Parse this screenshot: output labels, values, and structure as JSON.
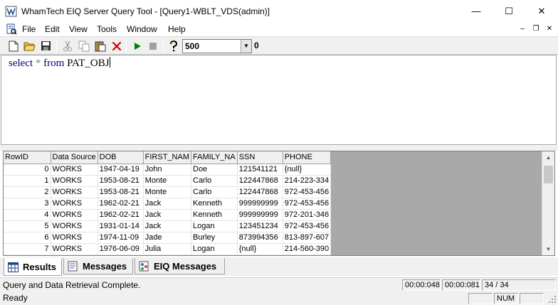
{
  "window": {
    "title": "WhamTech EIQ Server Query Tool - [Query1-WBLT_VDS(admin)]",
    "controls": {
      "minimize": "—",
      "maximize": "☐",
      "close": "✕"
    }
  },
  "menu": {
    "items": [
      "File",
      "Edit",
      "View",
      "Tools",
      "Window",
      "Help"
    ],
    "mdi_controls": {
      "minimize": "–",
      "restore": "❐",
      "close": "✕"
    }
  },
  "toolbar": {
    "row_limit_value": "500",
    "result_count": "0",
    "icons": [
      "new-document-icon",
      "open-folder-icon",
      "save-icon",
      "cut-icon",
      "copy-icon",
      "paste-icon",
      "delete-icon",
      "run-icon",
      "stop-icon",
      "help-icon"
    ]
  },
  "editor": {
    "kw_select": "select",
    "op_star": "*",
    "kw_from": "from",
    "table_name": "PAT_OBJ"
  },
  "grid": {
    "columns": [
      "RowID",
      "Data Source",
      "DOB",
      "FIRST_NAM",
      "FAMILY_NA",
      "SSN",
      "PHONE"
    ],
    "rows": [
      [
        "0",
        "WORKS",
        "1947-04-19",
        "John",
        "Doe",
        "121541121",
        "{null}"
      ],
      [
        "1",
        "WORKS",
        "1953-08-21",
        "Monte",
        "Carlo",
        "122447868",
        "214-223-334"
      ],
      [
        "2",
        "WORKS",
        "1953-08-21",
        "Monte",
        "Carlo",
        "122447868",
        "972-453-456"
      ],
      [
        "3",
        "WORKS",
        "1962-02-21",
        "Jack",
        "Kenneth",
        "999999999",
        "972-453-456"
      ],
      [
        "4",
        "WORKS",
        "1962-02-21",
        "Jack",
        "Kenneth",
        "999999999",
        "972-201-346"
      ],
      [
        "5",
        "WORKS",
        "1931-01-14",
        "Jack",
        "Logan",
        "123451234",
        "972-453-456"
      ],
      [
        "6",
        "WORKS",
        "1974-11-09",
        "Jade",
        "Burley",
        "873994356",
        "813-897-607"
      ],
      [
        "7",
        "WORKS",
        "1976-06-09",
        "Julia",
        "Logan",
        "{null}",
        "214-560-390"
      ]
    ]
  },
  "tabs": [
    {
      "label": "Results",
      "icon": "results-grid-icon",
      "active": true
    },
    {
      "label": "Messages",
      "icon": "messages-icon",
      "active": false
    },
    {
      "label": "EIQ Messages",
      "icon": "eiq-messages-icon",
      "active": false
    }
  ],
  "status": {
    "message": "Query and Data Retrieval Complete.",
    "time_1": "00:00:048",
    "time_2": "00:00:081",
    "row_count": "34 / 34",
    "ready": "Ready",
    "num_lock": "NUM"
  },
  "colors": {
    "keyword": "#000080",
    "operator": "#808080",
    "run_green": "#008000",
    "delete_red": "#d00000"
  }
}
